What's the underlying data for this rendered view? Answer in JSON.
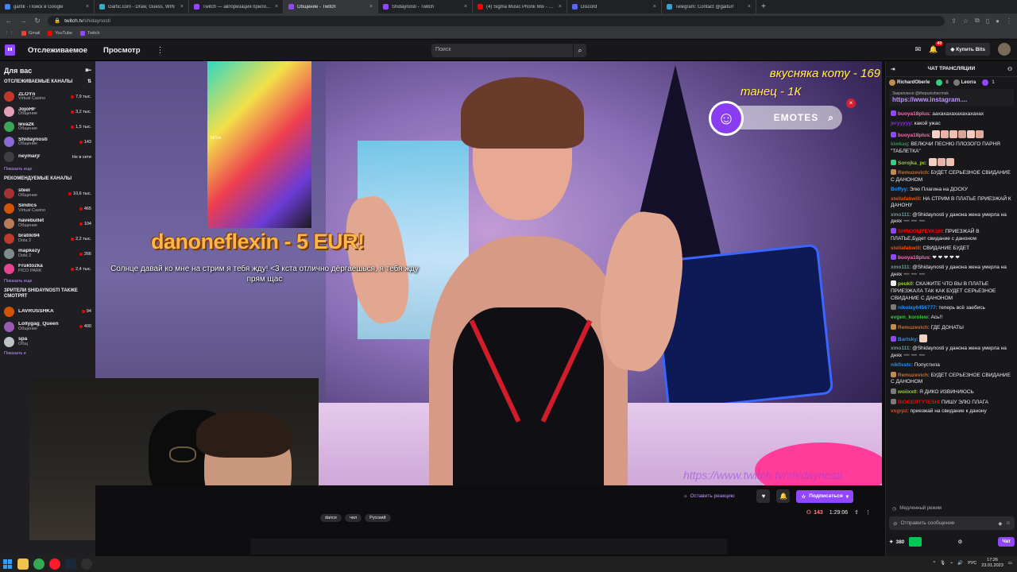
{
  "browser": {
    "tabs": [
      {
        "title": "gartik - Поиск в Google",
        "color": "#4285f4"
      },
      {
        "title": "Gartic.com - Draw, Guess, WIN",
        "color": "#2fb1c9"
      },
      {
        "title": "Twitch — авторизация приложе",
        "color": "#9147ff"
      },
      {
        "title": "Общение - Twitch",
        "color": "#9147ff",
        "active": true
      },
      {
        "title": "Shidaynosti - Twitch",
        "color": "#9147ff"
      },
      {
        "title": "(4) Sigma Music Phonk Mix - You",
        "color": "#ff0000"
      },
      {
        "title": "Discord",
        "color": "#5865f2"
      },
      {
        "title": "Telegram: Contact @gaiturr",
        "color": "#2aa3df"
      }
    ],
    "url_host": "twitch.tv",
    "url_path": "/shidaynosti",
    "bookmarks": [
      {
        "label": "Gmail",
        "color": "#ea4335"
      },
      {
        "label": "YouTube",
        "color": "#ff0000"
      },
      {
        "label": "Twitch",
        "color": "#9147ff"
      }
    ]
  },
  "twitch_nav": {
    "following": "Отслеживаемое",
    "browse": "Просмотр",
    "search_placeholder": "Поиск",
    "notifications_count": "40",
    "buy_bits": "Купить Bits"
  },
  "sidebar": {
    "title": "Для вас",
    "followed_title": "ОТСЛЕЖИВАЕМЫЕ КАНАЛЫ",
    "followed": [
      {
        "name": "ZLOYn",
        "category": "Virtual Casino",
        "viewers": "7,9 тыс.",
        "color": "#c0392b"
      },
      {
        "name": "JojoHF",
        "category": "Общение",
        "viewers": "3,2 тыс.",
        "color": "#e39fb6"
      },
      {
        "name": "leva2k",
        "category": "Общение",
        "viewers": "1,5 тыс.",
        "color": "#3aa657"
      },
      {
        "name": "Shidaynosti",
        "category": "Общение",
        "viewers": "143",
        "color": "#8a6ad6"
      },
      {
        "name": "neymarjr",
        "category": "",
        "viewers": "Не в сети",
        "color": "#555555",
        "offline": true
      }
    ],
    "show_more_1": "Показать еще",
    "recommended_title": "РЕКОМЕНДУЕМЫЕ КАНАЛЫ",
    "recommended": [
      {
        "name": "steel",
        "category": "Общение",
        "viewers": "10,6 тыс.",
        "color": "#a83232"
      },
      {
        "name": "Sindics",
        "category": "Virtual Casino",
        "viewers": "465",
        "color": "#d35400"
      },
      {
        "name": "havebullet",
        "category": "Общение",
        "viewers": "104",
        "color": "#b97a57"
      },
      {
        "name": "bratiki94",
        "category": "Dota 2",
        "viewers": "2,2 тыс.",
        "color": "#c0392b"
      },
      {
        "name": "mapkezy",
        "category": "Dota 2",
        "viewers": "266",
        "color": "#7f8c8d"
      },
      {
        "name": "Fruktozka",
        "category": "PICO PARK",
        "viewers": "2,4 тыс.",
        "color": "#e84393"
      }
    ],
    "show_more_2": "Показать еще",
    "also_watch_title": "ЗРИТЕЛИ SHIDAYNOSTI ТАКЖЕ СМОТРЯТ",
    "also_watch": [
      {
        "name": "LAVRUSSHKA",
        "category": "",
        "viewers": "94",
        "color": "#d35400"
      },
      {
        "name": "Lollygag_Queen",
        "category": "Общение",
        "viewers": "400",
        "color": "#9b59b6"
      },
      {
        "name": "spa",
        "category": "Общ",
        "viewers": "",
        "color": "#bdc3c7"
      }
    ],
    "show_more_3": "Показать е"
  },
  "video": {
    "donation_title": "danoneflexin - 5 EUR!",
    "donation_msg": "Солнце давай ко мне на стрим я тебя жду! <3 кста отлично дёргаешься, я тебя жду прям щас",
    "goal1": "вкусняка коту - 169",
    "goal2": "танец - 1К",
    "emotes_label": "EMOTES",
    "tiktok_label": "TikTok",
    "watermark": "https://www.twitch.tv/shidaynosti"
  },
  "under": {
    "reaction": "Оставить реакцию",
    "subscribe": "Подписаться",
    "tags": [
      "dance",
      "чил",
      "Русский"
    ],
    "viewers": "143",
    "uptime": "1:29:06"
  },
  "chat": {
    "title": "ЧАТ ТРАНСЛЯЦИИ",
    "gifters": [
      {
        "name": "RichardOberle",
        "count": "",
        "color": "#c38a4e"
      },
      {
        "name": "",
        "count": "8",
        "color": "#35d07f"
      },
      {
        "name": "Leorra",
        "count": "",
        "color": "#7a7a7a"
      },
      {
        "name": "",
        "count": "1",
        "color": "#9147ff"
      }
    ],
    "pinned_by": "Закреплено @thepunisherrmsk",
    "pinned_link": "https://www.instagram....",
    "messages": [
      {
        "user": "buoya18plus",
        "color": "#ff69b4",
        "text": "аахахахахахахахахах",
        "badge": "#9147ff"
      },
      {
        "user": "jeryyyyy",
        "color": "#8a2be2",
        "text": "какой ужас"
      },
      {
        "user": "buoya18plus",
        "color": "#ff69b4",
        "text": "",
        "badge": "#9147ff",
        "emotes": 6
      },
      {
        "user": "kiwkaq",
        "color": "#2e8b57",
        "text": "ВЕЛЮЧИ ПЕСНЮ ПЛОЗОГО ПАРНЯ \"ТАБЛЕТКА\""
      },
      {
        "user": "Sorojka_pc",
        "color": "#9acd32",
        "text": "",
        "badge": "#35d07f",
        "emotes": 3
      },
      {
        "user": "Remuzevich",
        "color": "#d2691e",
        "text": "БУДЕТ СЕРЬЕЗНОЕ СВИДАНИЕ С ДАНОНОМ",
        "badge": "#c38a4e"
      },
      {
        "user": "Boffyy",
        "color": "#1e90ff",
        "text": "Элю Плагина на ДОСКУ"
      },
      {
        "user": "stellafabwill",
        "color": "#ff4500",
        "text": "НА СТРИМ В ПЛАТЬЕ ПРИЕЗЖАЙ К ДАНОНУ"
      },
      {
        "user": "xmo111",
        "color": "#5f9ea0",
        "text": "@Shidaynosti у данона жена умерла на днях ➖ ➖ ➖"
      },
      {
        "user": "SHROOMYEVKSH",
        "color": "#ff0000",
        "text": "ПРИЕЗЖАЙ В ПЛАТЬЕ,Будет свидание с даноном",
        "badge": "#9147ff"
      },
      {
        "user": "stellafabwill",
        "color": "#ff4500",
        "text": "СВИДАНИЕ БУДЕТ"
      },
      {
        "user": "buoya18plus",
        "color": "#ff69b4",
        "text": "❤ ❤ ❤ ❤ ❤",
        "badge": "#9147ff"
      },
      {
        "user": "xmo111",
        "color": "#5f9ea0",
        "text": "@Shidaynosti у данона жена умерла на днях ➖ ➖ ➖"
      },
      {
        "user": "peuk0",
        "color": "#9acd32",
        "text": "СКАЖИТЕ ЧТО ВЫ В ПЛАТЬЕ ПРИЕЗЖАЛА ТАК КАК БУДЕТ СЕРЬЕЗНОЕ СВИДАНИЕ С ДАНОНОМ",
        "badge": "#efeff1"
      },
      {
        "user": "nikolay6456777",
        "color": "#1e90ff",
        "text": "теперь всё заебись",
        "badge": "#7a7a7a"
      },
      {
        "user": "evgen_korolew",
        "color": "#32cd32",
        "text": "Ась!!"
      },
      {
        "user": "Remuzevich",
        "color": "#d2691e",
        "text": "ГДЕ ДОНАТЫ",
        "badge": "#c38a4e"
      },
      {
        "user": "Bartsky",
        "color": "#1e90ff",
        "text": "",
        "badge": "#9147ff",
        "emotes": 1
      },
      {
        "user": "xmo111",
        "color": "#5f9ea0",
        "text": "@Shidaynosti у данона жена умерла на днях ➖ ➖ ➖"
      },
      {
        "user": "nik0sstc",
        "color": "#1e90ff",
        "text": "Попустила"
      },
      {
        "user": "Remuzevich",
        "color": "#d2691e",
        "text": "БУДЕТ СЕРЬЕЗНОЕ СВИДАНИЕ С ДАНОНОМ",
        "badge": "#c38a4e"
      },
      {
        "user": "woiixx0",
        "color": "#9acd32",
        "text": "Я ДИКО ИЗВИНИЮСЬ",
        "badge": "#7a7a7a"
      },
      {
        "user": "BIGGERTYTESH",
        "color": "#ff0000",
        "text": "ПИШУ ЭЛЮ ПЛАГА",
        "badge": "#7a7a7a"
      },
      {
        "user": "vxgrpz",
        "color": "#ff4500",
        "text": "приезжай на свидание к данону"
      }
    ],
    "slow_mode": "Медленный режим",
    "input_placeholder": "Отправить сообщение",
    "points": "380",
    "send_label": "Чат"
  },
  "taskbar": {
    "lang": "РУС",
    "time": "17:26",
    "date": "23.01.2023"
  }
}
